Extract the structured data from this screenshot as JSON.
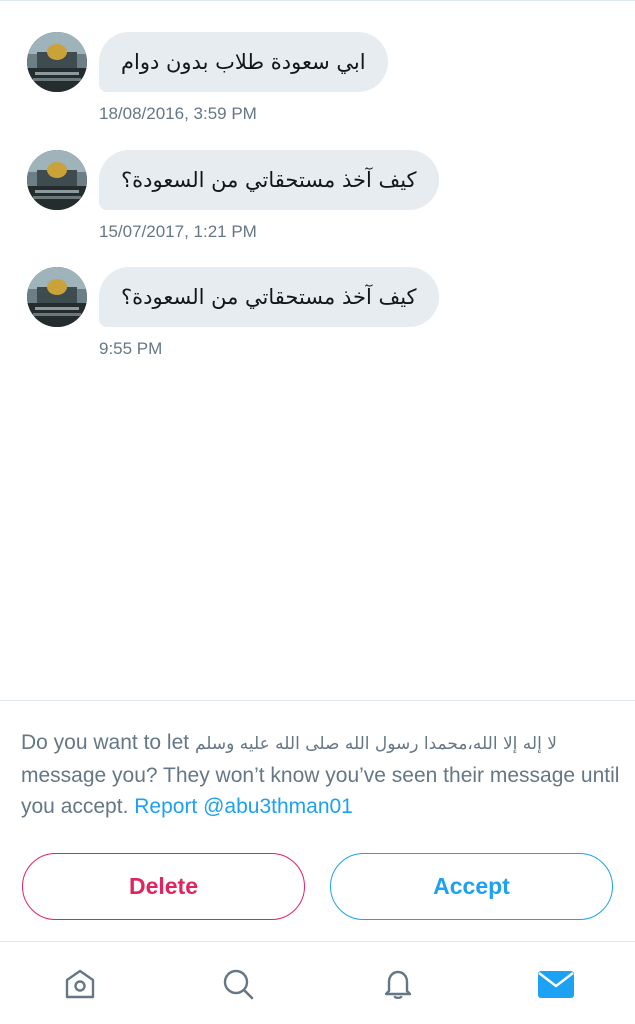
{
  "messages": [
    {
      "text": "ابي سعودة طلاب بدون دوام",
      "time": "18/08/2016, 3:59 PM"
    },
    {
      "text": "كيف آخذ مستحقاتي من السعودة؟",
      "time": "15/07/2017, 1:21 PM"
    },
    {
      "text": "كيف آخذ مستحقاتي من السعودة؟",
      "time": "9:55 PM"
    }
  ],
  "request": {
    "prefix": "Do you want to let ",
    "sender_name": "لا إله إلا الله،محمدا رسول الله صلى الله عليه وسلم",
    "suffix": " message you? They won’t know you’ve seen their message until you accept. ",
    "report_label": "Report @abu3thman01",
    "delete_label": "Delete",
    "accept_label": "Accept"
  },
  "tabbar": {
    "items": [
      {
        "icon": "home-icon",
        "active": false
      },
      {
        "icon": "search-icon",
        "active": false
      },
      {
        "icon": "bell-icon",
        "active": false
      },
      {
        "icon": "envelope-icon",
        "active": true
      }
    ]
  },
  "colors": {
    "accent": "#1da1f2",
    "danger": "#e0245e",
    "bubble": "#e6ecf0",
    "muted": "#657786"
  }
}
